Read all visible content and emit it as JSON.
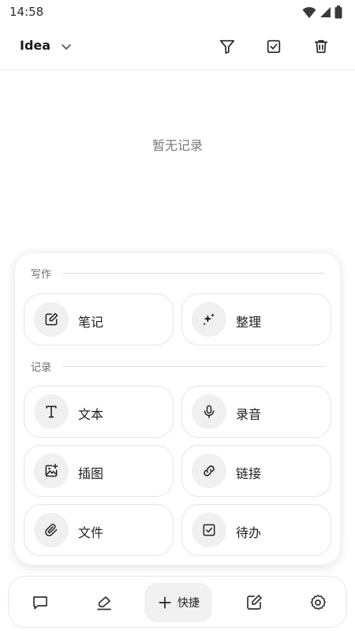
{
  "status_bar": {
    "time": "14:58"
  },
  "header": {
    "title": "Idea"
  },
  "main": {
    "empty_text": "暂无记录"
  },
  "panel": {
    "writing": {
      "label": "写作",
      "items": [
        "笔记",
        "整理"
      ]
    },
    "record": {
      "label": "记录",
      "items": [
        "文本",
        "录音",
        "插图",
        "链接",
        "文件",
        "待办"
      ]
    }
  },
  "bottom_nav": {
    "quick_label": "快捷"
  }
}
